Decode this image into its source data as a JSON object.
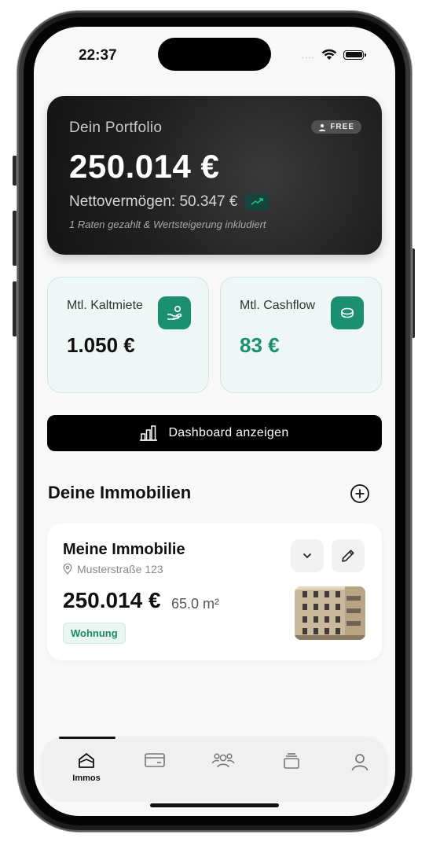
{
  "status_bar": {
    "time": "22:37",
    "signal_dots": "...."
  },
  "portfolio": {
    "label": "Dein Portfolio",
    "badge": "FREE",
    "value": "250.014 €",
    "net_worth": "Nettovermögen: 50.347 €",
    "note": "1 Raten gezahlt & Wertsteigerung inkludiert"
  },
  "stats": [
    {
      "label": "Mtl. Kaltmiete",
      "value": "1.050 €"
    },
    {
      "label": "Mtl. Cashflow",
      "value": "83 €"
    }
  ],
  "dashboard_button": {
    "label": "Dashboard anzeigen"
  },
  "properties_section": {
    "title": "Deine Immobilien"
  },
  "property": {
    "title": "Meine Immobilie",
    "address": "Musterstraße 123",
    "price": "250.014 €",
    "area": "65.0 m²",
    "type_badge": "Wohnung"
  },
  "tabbar": {
    "tabs": [
      {
        "label": "Immos",
        "icon": "home-icon",
        "active": true
      },
      {
        "label": "",
        "icon": "card-icon",
        "active": false
      },
      {
        "label": "",
        "icon": "people-icon",
        "active": false
      },
      {
        "label": "",
        "icon": "stack-icon",
        "active": false
      },
      {
        "label": "",
        "icon": "user-icon",
        "active": false
      }
    ]
  },
  "colors": {
    "accent_green": "#1a9071",
    "card_dark": "#1f1f1f",
    "stat_card_bg": "#eef7f5"
  }
}
